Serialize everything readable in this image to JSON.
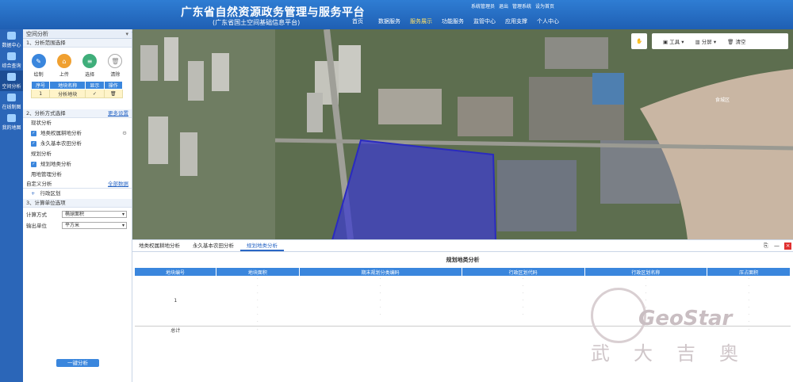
{
  "header": {
    "title": "广东省自然资源政务管理与服务平台",
    "subtitle": "(广东省国土空间基础信息平台)",
    "user_links": [
      "系统管理员",
      "退出",
      "管理系统",
      "设为首页"
    ],
    "nav": [
      "首页",
      "数据服务",
      "服务展示",
      "功能服务",
      "监管中心",
      "应用支撑",
      "个人中心"
    ],
    "active_nav": "服务展示"
  },
  "iconbar": [
    {
      "label": "数据中心"
    },
    {
      "label": "综合查询"
    },
    {
      "label": "空间分析"
    },
    {
      "label": "在线制图"
    },
    {
      "label": "我的地图"
    }
  ],
  "panel": {
    "title": "空间分析",
    "section1": "1、分析范围选择",
    "tools": [
      "绘制",
      "上传",
      "选择",
      "清除"
    ],
    "table_headers": [
      "序号",
      "地块名称",
      "显示",
      "操作"
    ],
    "table_row": [
      "1",
      "分析地块",
      "✓",
      "🗑"
    ],
    "section2": "2、分析方式选择",
    "section2_link": "更多设置",
    "current_analysis": "现状分析",
    "items_current": [
      "地类权属耕地分析",
      "永久基本农田分析"
    ],
    "planning_analysis": "规划分析",
    "items_planning": [
      "规划地类分析"
    ],
    "land_use_mgmt": "用地管理分析",
    "custom_analysis": "自定义分析",
    "custom_link": "全部数据",
    "admin_region": "行政区划",
    "section3": "3、计算单位选项",
    "calc_label": "计算方式",
    "calc_value": "椭球面积",
    "unit_label": "输出单位",
    "unit_value": "平方米",
    "run_button": "一键分析"
  },
  "map": {
    "tools": [
      "工具",
      "分屏",
      "清空"
    ],
    "place_label": "食城区"
  },
  "bottom": {
    "tabs": [
      "地类权属耕地分析",
      "永久基本农田分析",
      "规划地类分析"
    ],
    "active_tab": "规划地类分析",
    "title": "规划地类分析",
    "columns": [
      "地块编号",
      "地块面积",
      "期末规划分类编码",
      "行政区划代码",
      "行政区划名称",
      "压占面积"
    ],
    "row_key": "1",
    "total_label": "总计",
    "watermark_en": "GeoStar",
    "watermark_cn": "武大吉奥"
  },
  "colors": {
    "header": "#2f7dd3",
    "accent": "#3a86dd",
    "polygon": "#3c3ccf"
  }
}
